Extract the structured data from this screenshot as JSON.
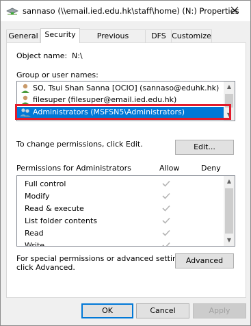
{
  "window": {
    "title": "sannaso (\\\\email.ied.edu.hk\\staff\\home) (N:) Properties",
    "close_icon": "close-icon"
  },
  "tabs": [
    {
      "label": "General"
    },
    {
      "label": "Security",
      "active": true
    },
    {
      "label": "Previous Versions"
    },
    {
      "label": "DFS"
    },
    {
      "label": "Customize"
    }
  ],
  "security": {
    "object_name_label": "Object name:",
    "object_name_value": "N:\\",
    "groups_label": "Group or user names:",
    "users": [
      {
        "name": "SO, Tsui Shan Sanna [OCIO] (sannaso@eduhk.hk)",
        "icon": "user-icon"
      },
      {
        "name": "filesuper (filesuper@email.ied.edu.hk)",
        "icon": "user-icon"
      },
      {
        "name": "Administrators (MSFSN5\\Administrators)",
        "icon": "group-icon",
        "selected": true
      }
    ],
    "change_hint": "To change permissions, click Edit.",
    "edit_button": "Edit...",
    "permissions_for": "Permissions for Administrators",
    "allow_header": "Allow",
    "deny_header": "Deny",
    "permissions": [
      {
        "name": "Full control",
        "allow": true,
        "deny": false
      },
      {
        "name": "Modify",
        "allow": true,
        "deny": false
      },
      {
        "name": "Read & execute",
        "allow": true,
        "deny": false
      },
      {
        "name": "List folder contents",
        "allow": true,
        "deny": false
      },
      {
        "name": "Read",
        "allow": true,
        "deny": false
      },
      {
        "name": "Write",
        "allow": true,
        "deny": false
      }
    ],
    "special_hint_line1": "For special permissions or advanced settings,",
    "special_hint_line2": "click Advanced.",
    "advanced_button": "Advanced"
  },
  "footer": {
    "ok": "OK",
    "cancel": "Cancel",
    "apply": "Apply"
  },
  "colors": {
    "selection": "#0078d7",
    "highlight_border": "#e21b2b",
    "check_gray": "#b4b4b4"
  }
}
